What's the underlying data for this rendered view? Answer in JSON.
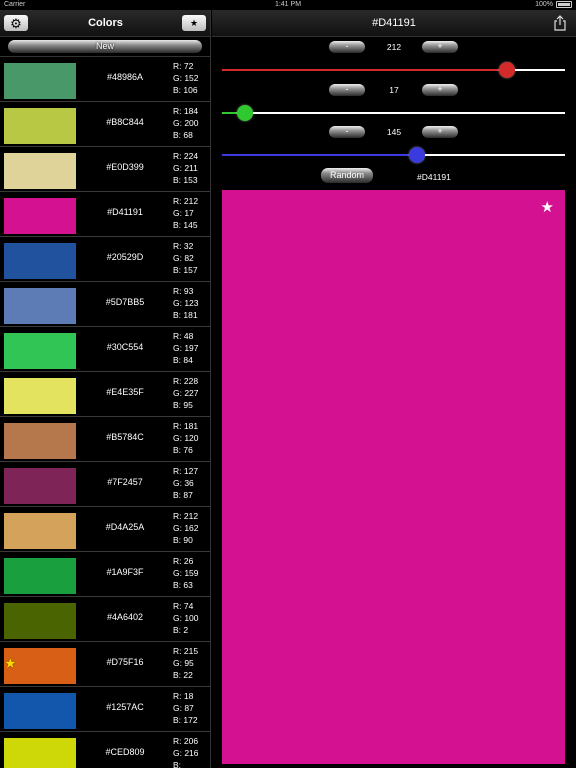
{
  "status_bar": {
    "carrier": "Carrier",
    "time": "1:41 PM",
    "battery": "100%"
  },
  "left": {
    "title": "Colors",
    "new_label": "New",
    "colors": [
      {
        "hex": "#48986A",
        "r": "R: 72",
        "g": "G: 152",
        "b": "B: 106",
        "color": "#48986A",
        "favorite": false
      },
      {
        "hex": "#B8C844",
        "r": "R: 184",
        "g": "G: 200",
        "b": "B: 68",
        "color": "#B8C844",
        "favorite": false
      },
      {
        "hex": "#E0D399",
        "r": "R: 224",
        "g": "G: 211",
        "b": "B: 153",
        "color": "#E0D399",
        "favorite": false
      },
      {
        "hex": "#D41191",
        "r": "R: 212",
        "g": "G: 17",
        "b": "B: 145",
        "color": "#D41191",
        "favorite": false
      },
      {
        "hex": "#20529D",
        "r": "R: 32",
        "g": "G: 82",
        "b": "B: 157",
        "color": "#20529D",
        "favorite": false
      },
      {
        "hex": "#5D7BB5",
        "r": "R: 93",
        "g": "G: 123",
        "b": "B: 181",
        "color": "#5D7BB5",
        "favorite": false
      },
      {
        "hex": "#30C554",
        "r": "R: 48",
        "g": "G: 197",
        "b": "B: 84",
        "color": "#30C554",
        "favorite": false
      },
      {
        "hex": "#E4E35F",
        "r": "R: 228",
        "g": "G: 227",
        "b": "B: 95",
        "color": "#E4E35F",
        "favorite": false
      },
      {
        "hex": "#B5784C",
        "r": "R: 181",
        "g": "G: 120",
        "b": "B: 76",
        "color": "#B5784C",
        "favorite": false
      },
      {
        "hex": "#7F2457",
        "r": "R: 127",
        "g": "G: 36",
        "b": "B: 87",
        "color": "#7F2457",
        "favorite": false
      },
      {
        "hex": "#D4A25A",
        "r": "R: 212",
        "g": "G: 162",
        "b": "B: 90",
        "color": "#D4A25A",
        "favorite": false
      },
      {
        "hex": "#1A9F3F",
        "r": "R: 26",
        "g": "G: 159",
        "b": "B: 63",
        "color": "#1A9F3F",
        "favorite": false
      },
      {
        "hex": "#4A6402",
        "r": "R: 74",
        "g": "G: 100",
        "b": "B: 2",
        "color": "#4A6402",
        "favorite": false
      },
      {
        "hex": "#D75F16",
        "r": "R: 215",
        "g": "G: 95",
        "b": "B: 22",
        "color": "#D75F16",
        "favorite": true
      },
      {
        "hex": "#1257AC",
        "r": "R: 18",
        "g": "G: 87",
        "b": "B: 172",
        "color": "#1257AC",
        "favorite": false
      },
      {
        "hex": "#CED809",
        "r": "R: 206",
        "g": "G: 216",
        "b": "B: ",
        "color": "#CED809",
        "favorite": false
      }
    ]
  },
  "editor": {
    "title": "#D41191",
    "red": {
      "value": "212",
      "level": 0.831,
      "color": "#d42a2a"
    },
    "green": {
      "value": "17",
      "level": 0.067,
      "color": "#2fc92f"
    },
    "blue": {
      "value": "145",
      "level": 0.569,
      "color": "#3a3adf"
    },
    "minus_label": "-",
    "plus_label": "+",
    "random_label": "Random",
    "hex_readout": "#D41191",
    "preview_color": "#D41191"
  },
  "icons": {
    "settings": "gear-icon",
    "favorites": "star-icon",
    "share": "share-icon",
    "favorite_marker": "star-icon"
  }
}
